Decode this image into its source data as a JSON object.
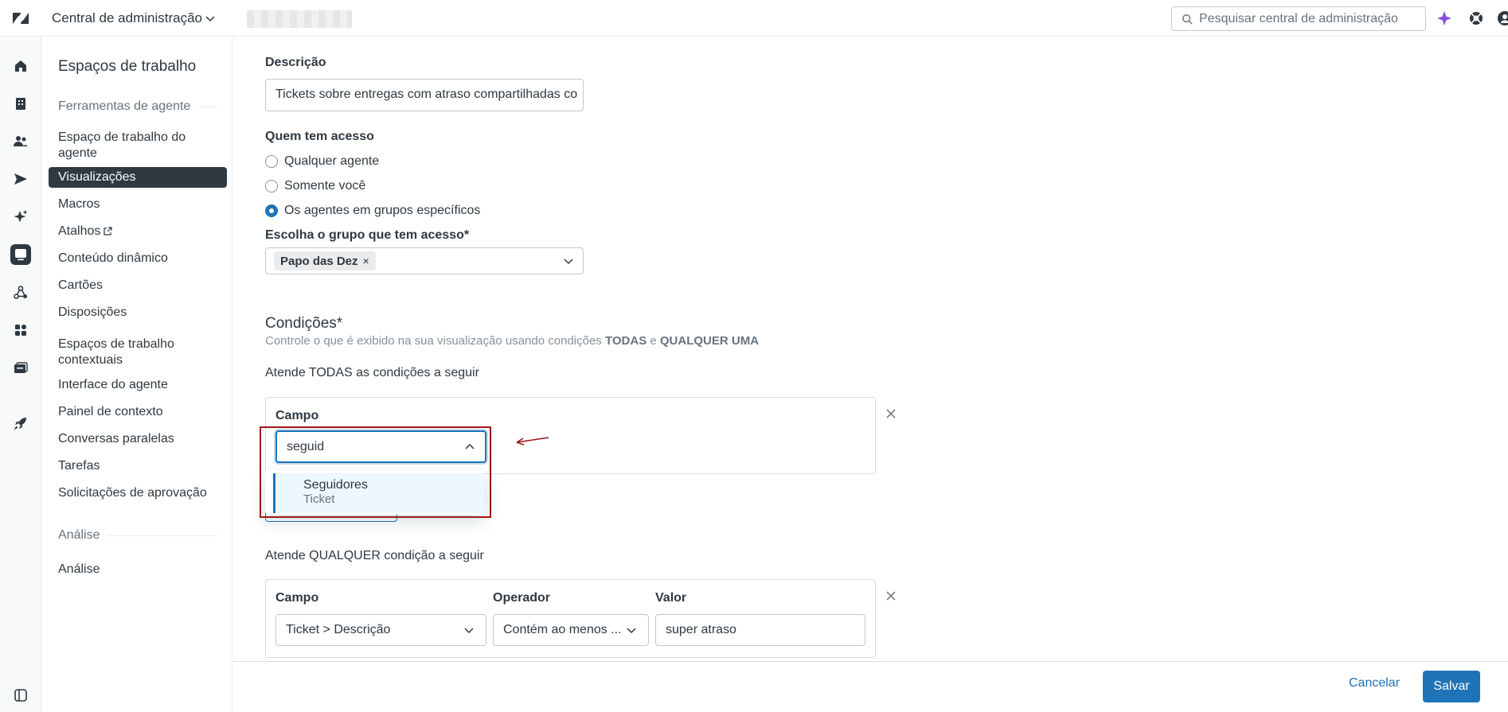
{
  "header": {
    "app_title": "Central de administração",
    "search_placeholder": "Pesquisar central de administração",
    "accent_color": "#1f73b7"
  },
  "rail": {
    "icons": [
      "home-icon",
      "building-icon",
      "people-icon",
      "send-icon",
      "sparkle-icon",
      "workspace-icon",
      "objects-icon",
      "apps-icon",
      "channels-icon",
      "rocket-icon"
    ],
    "active": "workspace-icon"
  },
  "sidebar": {
    "heading": "Espaços de trabalho",
    "section1": "Ferramentas de agente",
    "items": [
      {
        "label": "Espaço de trabalho do agente"
      },
      {
        "label": "Visualizações"
      },
      {
        "label": "Macros"
      },
      {
        "label": "Atalhos"
      },
      {
        "label": "Conteúdo dinâmico"
      },
      {
        "label": "Cartões"
      },
      {
        "label": "Disposições"
      },
      {
        "label": "Espaços de trabalho contextuais"
      },
      {
        "label": "Interface do agente"
      },
      {
        "label": "Painel de contexto"
      },
      {
        "label": "Conversas paralelas"
      },
      {
        "label": "Tarefas"
      },
      {
        "label": "Solicitações de aprovação"
      }
    ],
    "active_item": "Visualizações",
    "section2": "Análise",
    "analysis_items": [
      {
        "label": "Análise"
      }
    ]
  },
  "form": {
    "description_label": "Descrição",
    "description_value": "Tickets sobre entregas com atraso compartilhadas co",
    "access_label": "Quem tem acesso",
    "access_options": [
      "Qualquer agente",
      "Somente você",
      "Os agentes em grupos específicos"
    ],
    "access_selected": "Os agentes em grupos específicos",
    "group_label": "Escolha o grupo que tem acesso*",
    "group_chip": "Papo das Dez",
    "conditions_title": "Condições*",
    "conditions_desc_prefix": "Controle o que é exibido na sua visualização usando condições",
    "conditions_desc_all": "TODAS",
    "conditions_desc_and": "e",
    "conditions_desc_any": "QUALQUER UMA",
    "all_label": "Atende TODAS as condições a seguir",
    "all_field_label": "Campo",
    "all_field_input": "seguid",
    "dropdown_option_title": "Seguidores",
    "dropdown_option_subtitle": "Ticket",
    "any_label": "Atende QUALQUER condição a seguir",
    "any_field_label": "Campo",
    "any_operator_label": "Operador",
    "any_value_label": "Valor",
    "any_field_value": "Ticket > Descrição",
    "any_operator_value": "Contém ao menos ...",
    "any_value_value": "super atraso"
  },
  "footer": {
    "cancel_label": "Cancelar",
    "save_label": "Salvar"
  }
}
